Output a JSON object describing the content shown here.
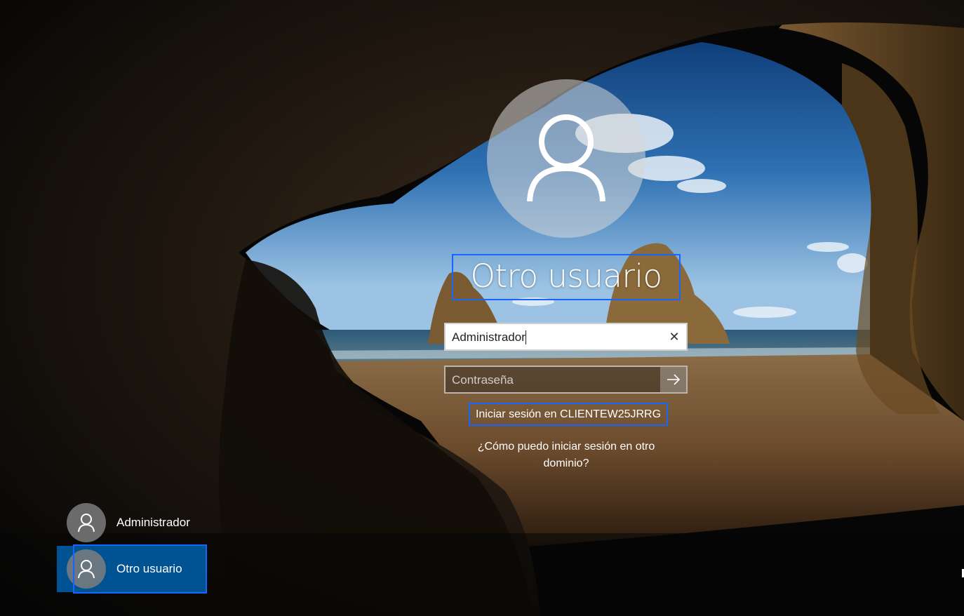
{
  "login": {
    "title": "Otro usuario",
    "username_value": "Administrador",
    "password_placeholder": "Contraseña",
    "signin_to": "Iniciar sesión en CLIENTEW25JRRG",
    "other_domain_line1": "¿Cómo puedo iniciar sesión en otro",
    "other_domain_line2": "dominio?",
    "clear_glyph": "✕"
  },
  "users": [
    {
      "name": "Administrador",
      "icon": "user-icon",
      "selected": false
    },
    {
      "name": "Otro usuario",
      "icon": "user-icon",
      "selected": true
    }
  ],
  "icons": {
    "avatar": "user-icon",
    "submit": "arrow-right-icon",
    "clear": "close-icon"
  },
  "colors": {
    "focus_outline": "#1565ff",
    "selected_tile": "#005a9e"
  }
}
